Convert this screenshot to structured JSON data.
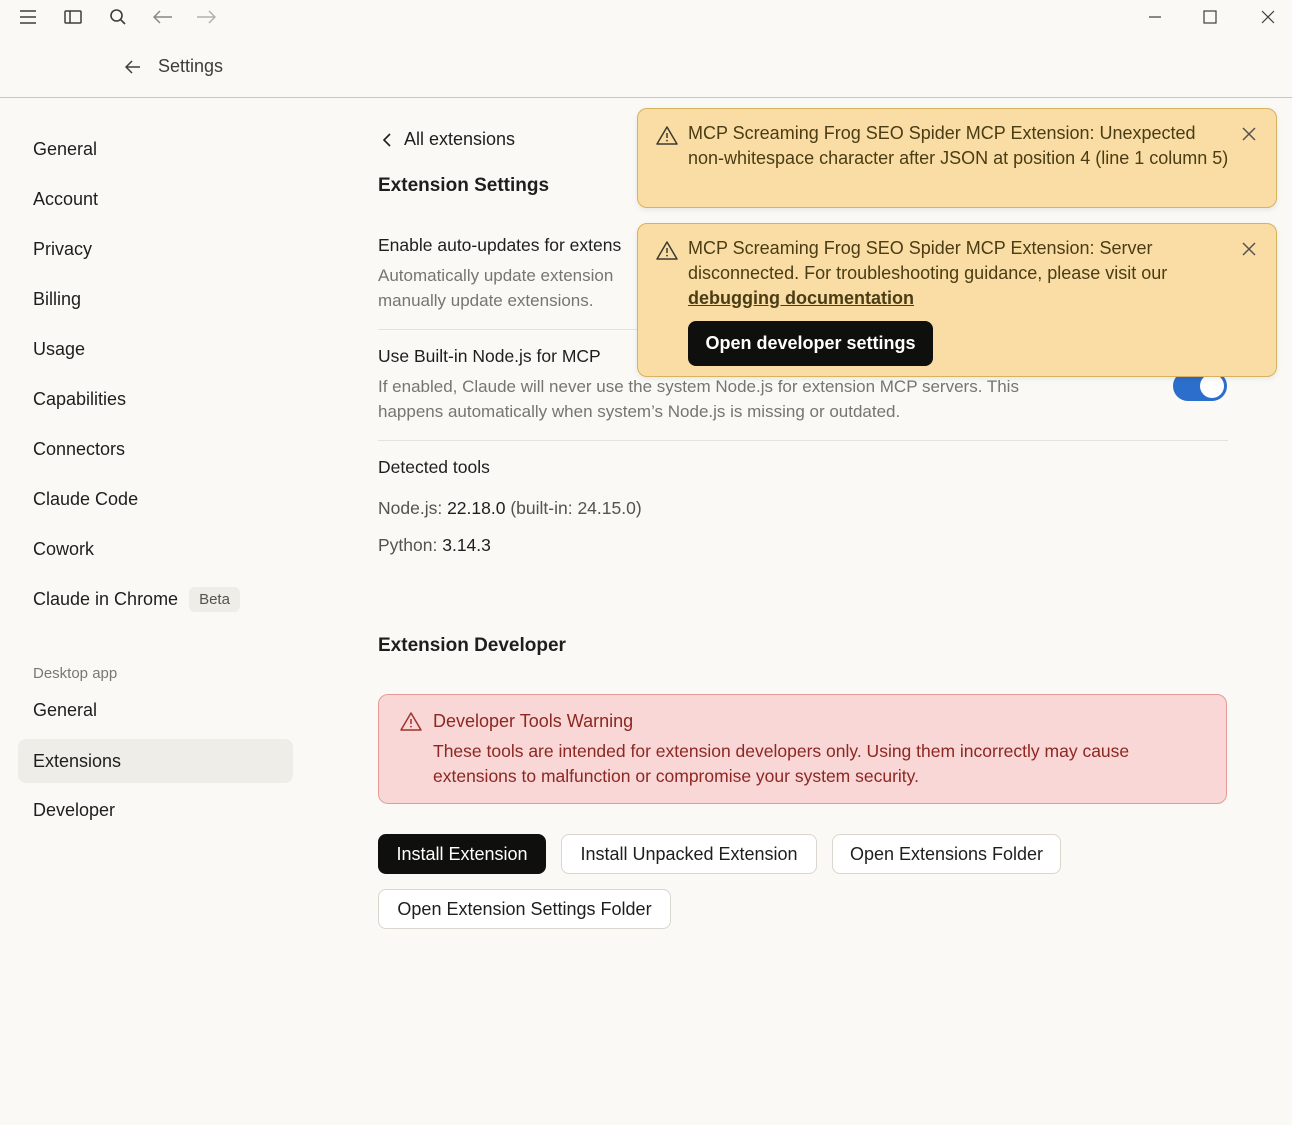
{
  "window": {
    "icons": [
      "menu-icon",
      "sidebar-toggle-icon",
      "search-icon",
      "back-icon",
      "forward-icon",
      "minimize-icon",
      "maximize-icon",
      "close-icon"
    ]
  },
  "header": {
    "title": "Settings"
  },
  "sidebar": {
    "items": [
      {
        "label": "General"
      },
      {
        "label": "Account"
      },
      {
        "label": "Privacy"
      },
      {
        "label": "Billing"
      },
      {
        "label": "Usage"
      },
      {
        "label": "Capabilities"
      },
      {
        "label": "Connectors"
      },
      {
        "label": "Claude Code"
      },
      {
        "label": "Cowork"
      },
      {
        "label": "Claude in Chrome",
        "badge": "Beta"
      }
    ],
    "desktop_section_label": "Desktop app",
    "desktop_items": [
      {
        "label": "General"
      },
      {
        "label": "Extensions",
        "active": true
      },
      {
        "label": "Developer"
      }
    ]
  },
  "main": {
    "back_link": "All extensions",
    "extension_settings_heading": "Extension Settings",
    "auto_update": {
      "title": "Enable auto-updates for extens",
      "desc": "Automatically update extension\nmanually update extensions."
    },
    "builtin_node": {
      "title": "Use Built-in Node.js for MCP",
      "desc": "If enabled, Claude will never use the system Node.js for extension MCP servers. This happens automatically when system’s Node.js is missing or outdated.",
      "enabled": true
    },
    "detected_tools": {
      "heading": "Detected tools",
      "node_label": "Node.js:",
      "node_value": "22.18.0",
      "node_builtin": "(built-in: 24.15.0)",
      "python_label": "Python:",
      "python_value": "3.14.3"
    },
    "developer_heading": "Extension Developer",
    "warning": {
      "title": "Developer Tools Warning",
      "text": "These tools are intended for extension developers only. Using them incorrectly may cause extensions to malfunction or compromise your system security."
    },
    "buttons": {
      "install": "Install Extension",
      "install_unpacked": "Install Unpacked Extension",
      "open_folder": "Open Extensions Folder",
      "open_settings_folder": "Open Extension Settings Folder"
    }
  },
  "toasts": [
    {
      "text": "MCP Screaming Frog SEO Spider MCP Extension: Unexpected non-whitespace character after JSON at position 4 (line 1 column 5)"
    },
    {
      "text": "MCP Screaming Frog SEO Spider MCP Extension: Server disconnected. For troubleshooting guidance, please visit our",
      "link": "debugging documentation",
      "button": "Open developer settings"
    }
  ],
  "colors": {
    "background": "#faf9f5",
    "toast_bg": "#f9dda4",
    "warning_bg": "#f9d7d6",
    "toggle_on": "#2c6ecb",
    "active_nav": "#efede7"
  }
}
